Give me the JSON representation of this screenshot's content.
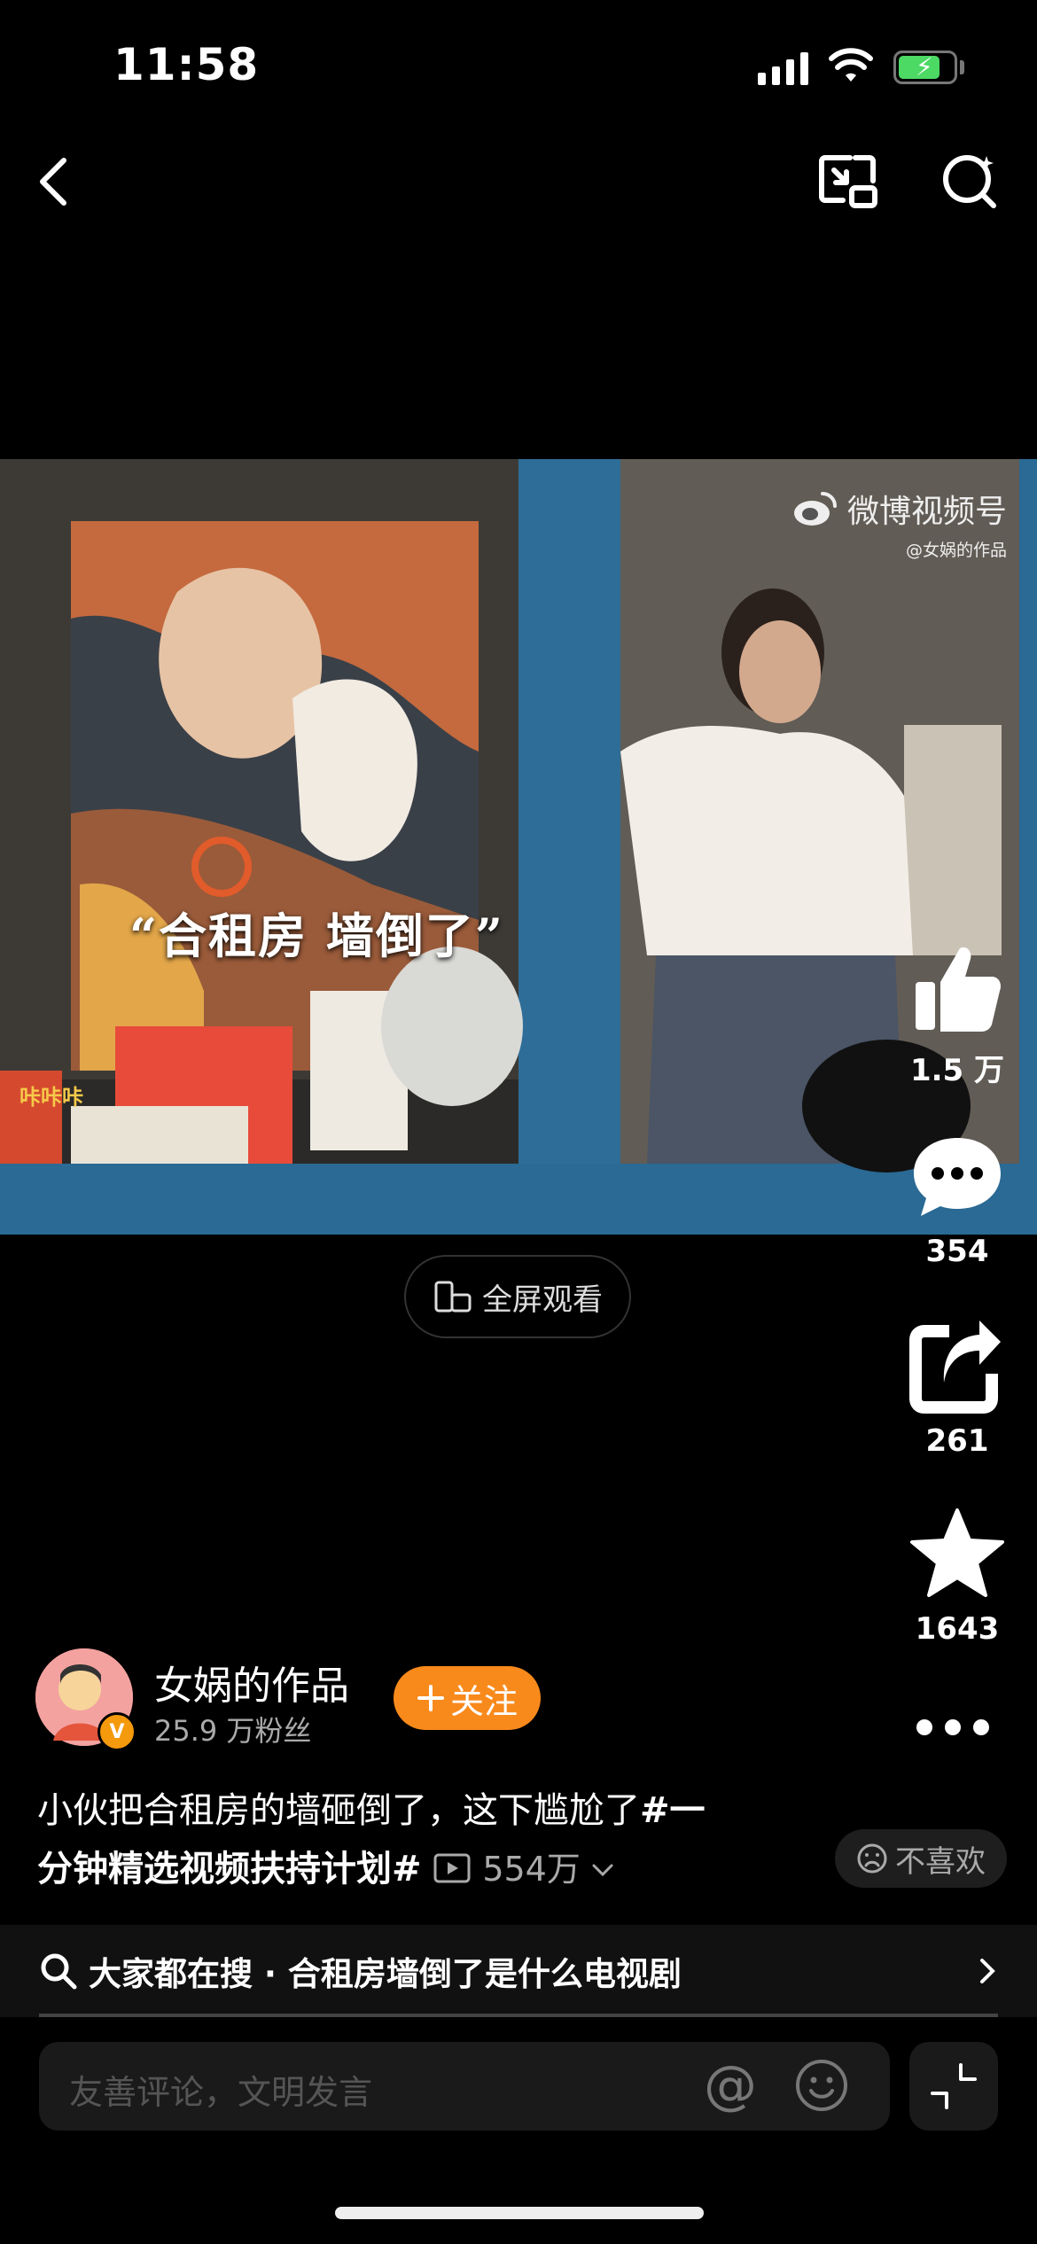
{
  "status_bar": {
    "time": "11:58"
  },
  "video": {
    "caption": "“合租房  墙倒了”",
    "watermark_main": "微博视频号",
    "watermark_sub": "@女娲的作品",
    "sticker_text": "咔咔咔"
  },
  "fullscreen_label": "全屏观看",
  "actions": {
    "like_count": "1.5 万",
    "comment_count": "354",
    "share_count": "261",
    "favorite_count": "1643"
  },
  "author": {
    "name": "女娲的作品",
    "fans": "25.9 万粉丝",
    "follow_label": "关注",
    "badge": "V"
  },
  "description": {
    "text": "小伙把合租房的墙砸倒了，这下尴尬了",
    "tag_line1": "#一",
    "tag_line2": "分钟精选视频扶持计划#",
    "views": "554万"
  },
  "dislike_label": "不喜欢",
  "hot_search": {
    "text": "大家都在搜 · 合租房墙倒了是什么电视剧"
  },
  "comment_input": {
    "placeholder": "友善评论，文明发言"
  },
  "colors": {
    "accent": "#f88a1c",
    "background": "#000000"
  }
}
